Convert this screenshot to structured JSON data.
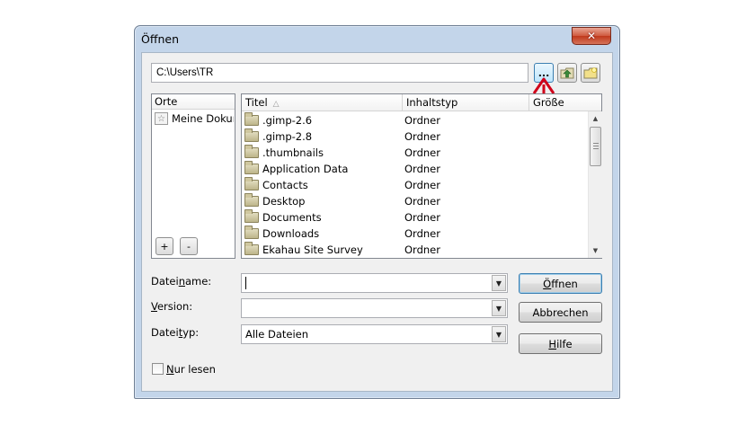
{
  "window": {
    "title": "Öffnen",
    "close_glyph": "✕"
  },
  "toolbar": {
    "path_value": "C:\\Users\\TR",
    "browse_label": "...",
    "up_icon": "up-folder-icon",
    "newfolder_icon": "new-folder-icon"
  },
  "places": {
    "header": "Orte",
    "items": [
      {
        "label": "Meine Dokumente",
        "icon": "favorite-star-icon"
      }
    ],
    "add_label": "+",
    "remove_label": "-"
  },
  "files": {
    "columns": [
      "Titel",
      "Inhaltstyp",
      "Größe"
    ],
    "rows": [
      {
        "name": ".gimp-2.6",
        "type": "Ordner"
      },
      {
        "name": ".gimp-2.8",
        "type": "Ordner"
      },
      {
        "name": ".thumbnails",
        "type": "Ordner"
      },
      {
        "name": "Application Data",
        "type": "Ordner"
      },
      {
        "name": "Contacts",
        "type": "Ordner"
      },
      {
        "name": "Desktop",
        "type": "Ordner"
      },
      {
        "name": "Documents",
        "type": "Ordner"
      },
      {
        "name": "Downloads",
        "type": "Ordner"
      },
      {
        "name": "Ekahau Site Survey",
        "type": "Ordner"
      }
    ]
  },
  "form": {
    "filename_label_pre": "Datei",
    "filename_label_u": "n",
    "filename_label_post": "ame:",
    "filename_value": "",
    "version_label_u": "V",
    "version_label_post": "ersion:",
    "version_value": "",
    "filetype_label_pre": "Datei",
    "filetype_label_u": "t",
    "filetype_label_post": "yp:",
    "filetype_value": "Alle Dateien",
    "readonly_label_u": "N",
    "readonly_label_post": "ur lesen",
    "readonly_checked": false
  },
  "buttons": {
    "open_u": "Ö",
    "open_post": "ffnen",
    "cancel": "Abbrechen",
    "help_u": "H",
    "help_post": "ilfe"
  },
  "annotation": {
    "arrow_color": "#d0001a"
  }
}
